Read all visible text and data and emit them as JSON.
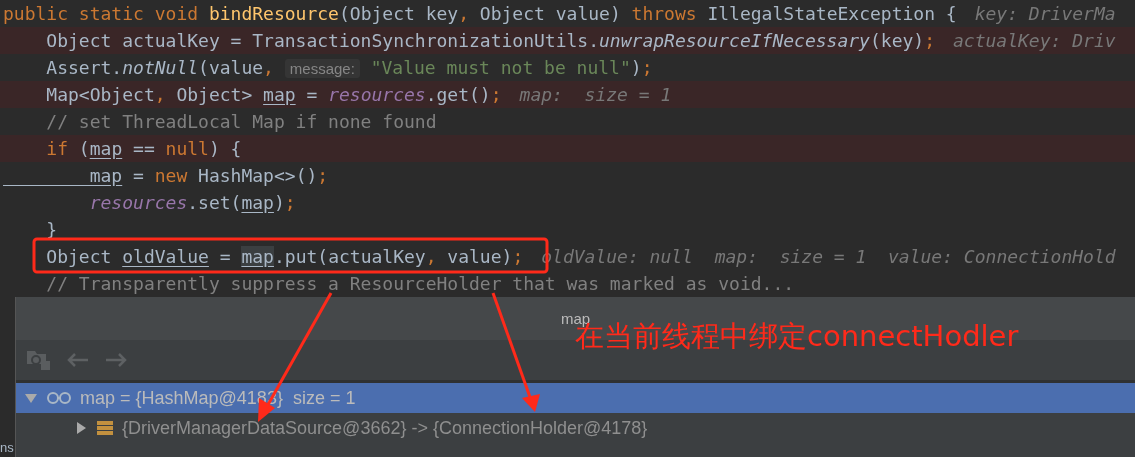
{
  "editor": {
    "lines": [
      {
        "highlighted": false,
        "tokens": [
          {
            "text": "public static void ",
            "kind": "keyword"
          },
          {
            "text": "bindResource",
            "kind": "method_decl"
          },
          {
            "text": "(Object key",
            "kind": "plain"
          },
          {
            "text": ", ",
            "kind": "punct"
          },
          {
            "text": "Object value) ",
            "kind": "plain"
          },
          {
            "text": "throws ",
            "kind": "keyword"
          },
          {
            "text": "IllegalStateException {",
            "kind": "plain"
          }
        ],
        "hint": "key: DriverMa"
      },
      {
        "highlighted": true,
        "tokens": [
          {
            "text": "    Object actualKey = TransactionSynchronizationUtils.",
            "kind": "plain"
          },
          {
            "text": "unwrapResourceIfNecessary",
            "kind": "static_call"
          },
          {
            "text": "(key)",
            "kind": "plain"
          },
          {
            "text": ";",
            "kind": "punct"
          }
        ],
        "hint": "actualKey: Driv"
      },
      {
        "highlighted": false,
        "tokens": [
          {
            "text": "    Assert.",
            "kind": "plain"
          },
          {
            "text": "notNull",
            "kind": "static_call"
          },
          {
            "text": "(value",
            "kind": "plain"
          },
          {
            "text": ", ",
            "kind": "punct"
          },
          {
            "text": "message:",
            "kind": "param_hint"
          },
          {
            "text": " \"Value must not be null\"",
            "kind": "string"
          },
          {
            "text": ")",
            "kind": "plain"
          },
          {
            "text": ";",
            "kind": "punct"
          }
        ]
      },
      {
        "highlighted": true,
        "tokens": [
          {
            "text": "    Map<Object",
            "kind": "plain"
          },
          {
            "text": ", ",
            "kind": "punct"
          },
          {
            "text": "Object> ",
            "kind": "plain"
          },
          {
            "text": "map",
            "kind": "local_var"
          },
          {
            "text": " = ",
            "kind": "plain"
          },
          {
            "text": "resources",
            "kind": "field"
          },
          {
            "text": ".get()",
            "kind": "plain"
          },
          {
            "text": ";",
            "kind": "punct"
          }
        ],
        "hint": "map:  size = 1"
      },
      {
        "highlighted": false,
        "tokens": [
          {
            "text": "    // set ThreadLocal Map if none found",
            "kind": "comment"
          }
        ]
      },
      {
        "highlighted": true,
        "tokens": [
          {
            "text": "    if ",
            "kind": "keyword"
          },
          {
            "text": "(",
            "kind": "plain"
          },
          {
            "text": "map",
            "kind": "local_var"
          },
          {
            "text": " == ",
            "kind": "plain"
          },
          {
            "text": "null",
            "kind": "keyword"
          },
          {
            "text": ") {",
            "kind": "plain"
          }
        ]
      },
      {
        "highlighted": false,
        "tokens": [
          {
            "text": "        map",
            "kind": "local_var"
          },
          {
            "text": " = ",
            "kind": "plain"
          },
          {
            "text": "new ",
            "kind": "keyword"
          },
          {
            "text": "HashMap<>()",
            "kind": "plain"
          },
          {
            "text": ";",
            "kind": "punct"
          }
        ]
      },
      {
        "highlighted": false,
        "tokens": [
          {
            "text": "        resources",
            "kind": "field"
          },
          {
            "text": ".set(",
            "kind": "plain"
          },
          {
            "text": "map",
            "kind": "local_var"
          },
          {
            "text": ")",
            "kind": "plain"
          },
          {
            "text": ";",
            "kind": "punct"
          }
        ]
      },
      {
        "highlighted": false,
        "tokens": [
          {
            "text": "    }",
            "kind": "plain"
          }
        ]
      },
      {
        "highlighted": false,
        "tokens": [
          {
            "text": "    Object ",
            "kind": "plain"
          },
          {
            "text": "oldValue",
            "kind": "local_var"
          },
          {
            "text": " = ",
            "kind": "plain"
          },
          {
            "text": "map",
            "kind": "usage"
          },
          {
            "text": ".put(actualKey",
            "kind": "plain"
          },
          {
            "text": ", ",
            "kind": "punct"
          },
          {
            "text": "value)",
            "kind": "plain"
          },
          {
            "text": ";",
            "kind": "punct"
          }
        ],
        "hint": "oldValue: null  map:  size = 1  value: ConnectionHold"
      },
      {
        "highlighted": false,
        "tokens": [
          {
            "text": "    // Transparently suppress a ResourceHolder that was marked as void...",
            "kind": "comment"
          }
        ]
      }
    ]
  },
  "side_fragment": "ns",
  "popup": {
    "title": "map",
    "tree": [
      {
        "label": "map = {HashMap@4183}  size = 1",
        "kind": "watch",
        "expanded": true,
        "selected": true,
        "children": [
          {
            "label": "{DriverManagerDataSource@3662} -> {ConnectionHolder@4178}",
            "kind": "entry",
            "expanded": false,
            "selected": false
          }
        ]
      }
    ]
  },
  "annotation": {
    "text": "在当前线程中绑定connectHodler"
  }
}
